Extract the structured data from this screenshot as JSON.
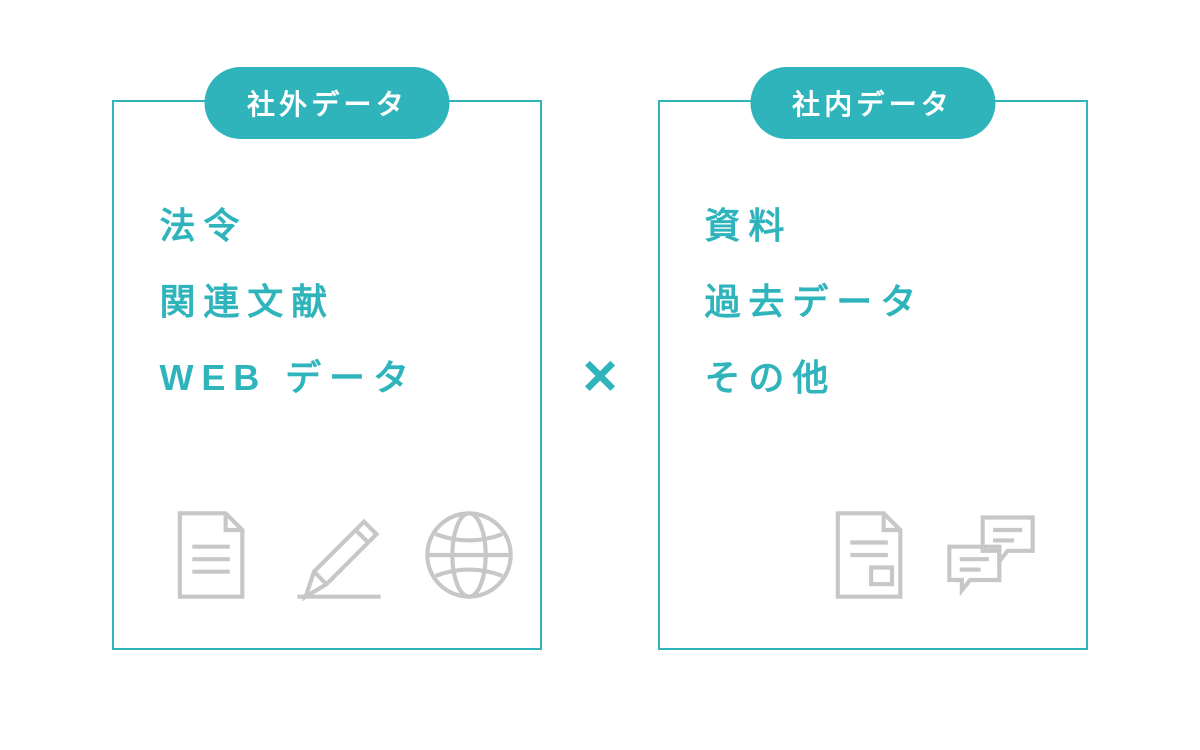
{
  "left": {
    "title": "社外データ",
    "items": [
      "法令",
      "関連文献",
      "WEB データ"
    ]
  },
  "operator": "×",
  "right": {
    "title": "社内データ",
    "items": [
      "資料",
      "過去データ",
      "その他"
    ]
  },
  "colors": {
    "accent": "#2fb4bc",
    "icon": "#c7c7c7"
  }
}
